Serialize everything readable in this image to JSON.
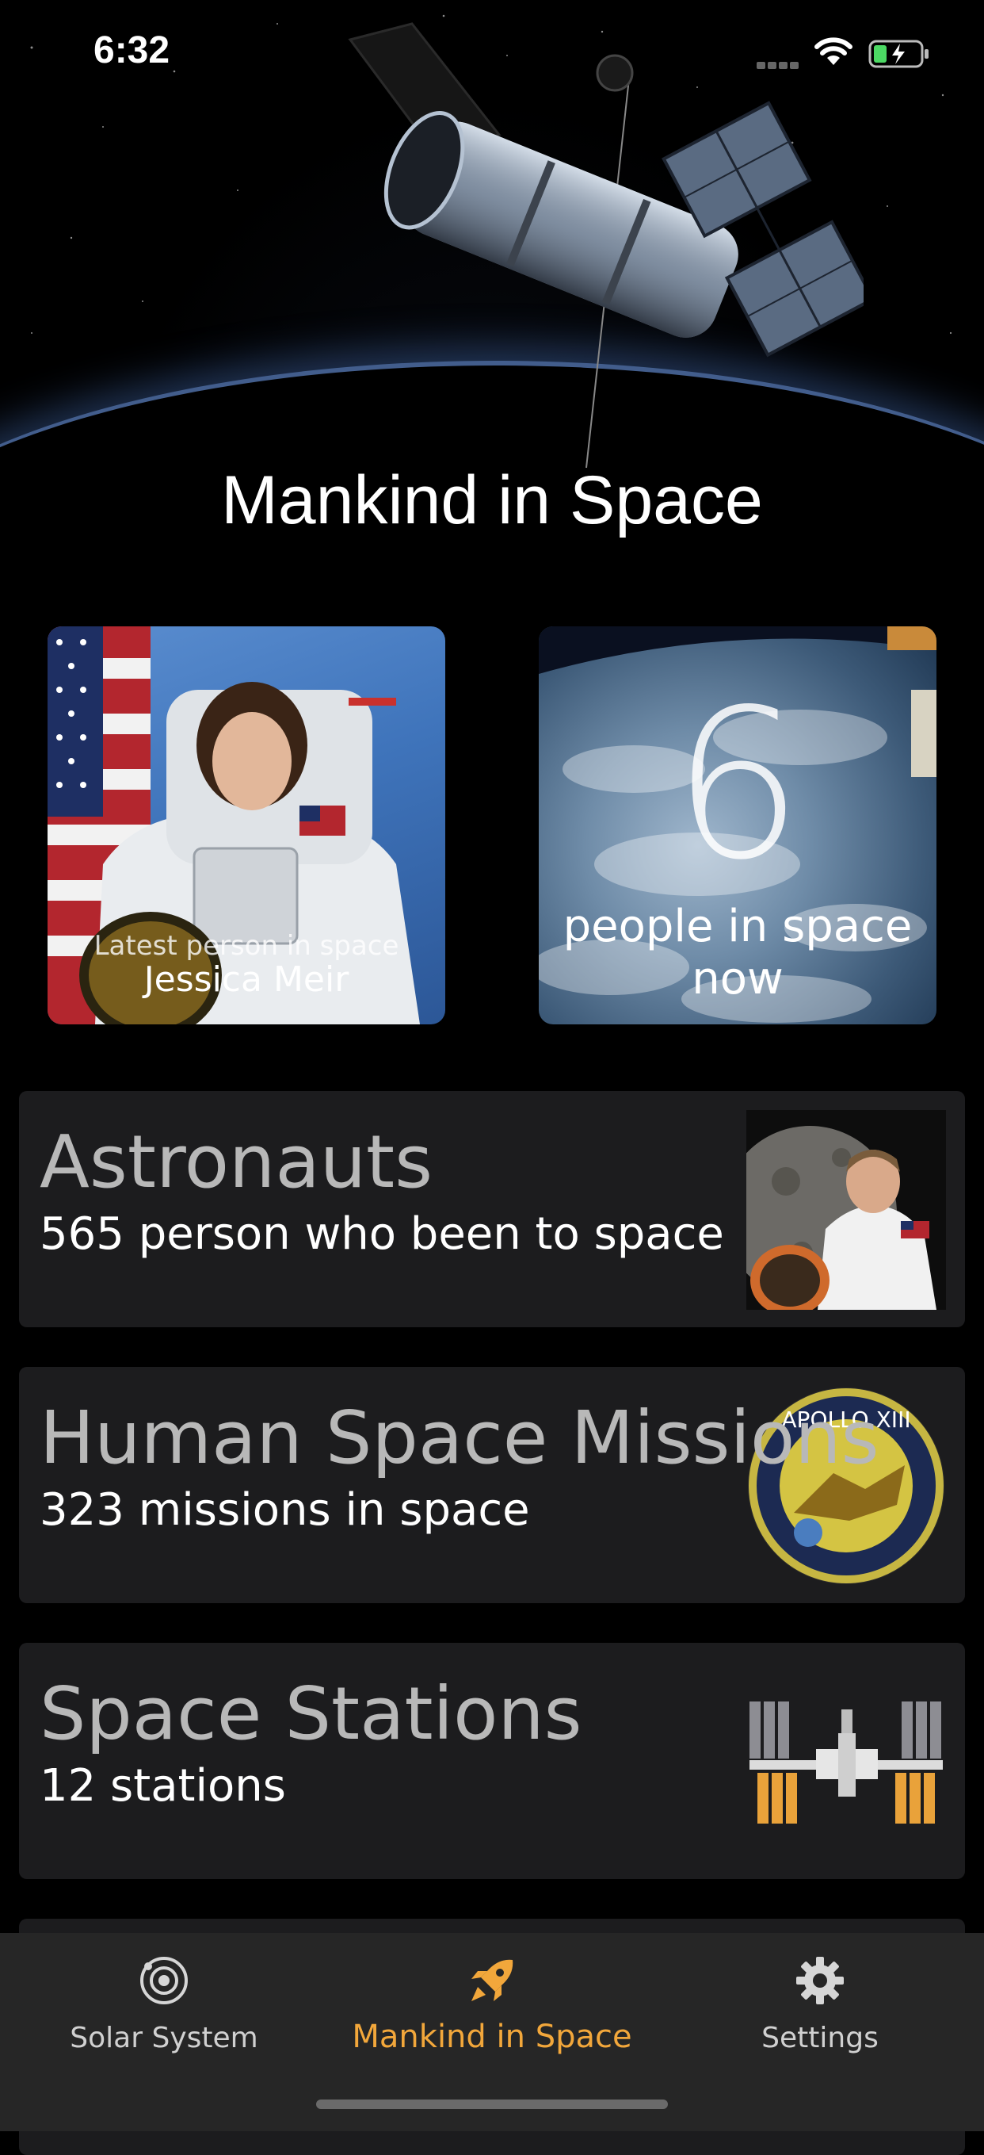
{
  "status_bar": {
    "time": "6:32"
  },
  "hero": {
    "title": "Mankind in Space"
  },
  "feature_cards": {
    "latest": {
      "caption": "Latest person in space",
      "name": "Jessica Meir"
    },
    "people": {
      "count": "6",
      "label_line1": "people in space",
      "label_line2": "now"
    }
  },
  "list": [
    {
      "title": "Astronauts",
      "subtitle": "565 person who been to space",
      "icon": "armstrong-portrait"
    },
    {
      "title": "Human Space Missions",
      "subtitle": "323 missions in space",
      "icon": "apollo-xiii-patch",
      "patch_text": "APOLLO XIII"
    },
    {
      "title": "Space Stations",
      "subtitle": "12 stations",
      "icon": "iss-station"
    }
  ],
  "tab_bar": {
    "tabs": [
      {
        "label": "Solar System",
        "icon": "orbit-icon"
      },
      {
        "label": "Mankind in Space",
        "icon": "rocket-icon",
        "active": true
      },
      {
        "label": "Settings",
        "icon": "gear-icon"
      }
    ]
  },
  "colors": {
    "accent": "#f2a73b",
    "row_bg": "#1c1c1e",
    "tab_bg": "#262626"
  }
}
